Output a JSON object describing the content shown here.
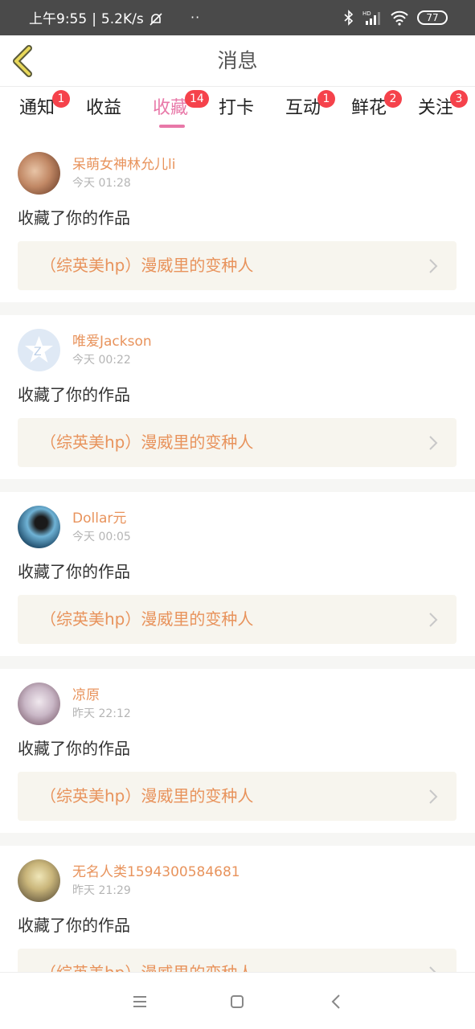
{
  "status_bar": {
    "time": "上午9:55",
    "network_speed": "5.2K/s",
    "dots": "··",
    "battery": "77",
    "icons": [
      "alarm-off-icon",
      "bluetooth-icon",
      "hd-signal-icon",
      "wifi-icon",
      "battery-icon"
    ]
  },
  "header": {
    "title": "消息",
    "back_icon": "chevron-left-icon",
    "accent": "#e8d85a"
  },
  "tabs": [
    {
      "label": "通知",
      "badge": "1"
    },
    {
      "label": "收益",
      "badge": ""
    },
    {
      "label": "收藏",
      "badge": "14",
      "active": true
    },
    {
      "label": "打卡",
      "badge": ""
    },
    {
      "label": "互动",
      "badge": "1"
    },
    {
      "label": "鲜花",
      "badge": "2"
    },
    {
      "label": "关注",
      "badge": "3"
    }
  ],
  "feed": [
    {
      "username": "呆萌女神林允儿li",
      "time": "今天 01:28",
      "action": "收藏了你的作品",
      "work_title": "（综英美hp）漫威里的变种人",
      "avatar_colors": [
        "#e4c1a3",
        "#6b3a24"
      ]
    },
    {
      "username": "唯爱Jackson",
      "time": "今天 00:22",
      "action": "收藏了你的作品",
      "work_title": "（综英美hp）漫威里的变种人",
      "avatar_colors": [
        "#dce8f5",
        "#ffffff"
      ]
    },
    {
      "username": "Dollar元",
      "time": "今天 00:05",
      "action": "收藏了你的作品",
      "work_title": "（综英美hp）漫威里的变种人",
      "avatar_colors": [
        "#3a8fb7",
        "#1b2d3a"
      ]
    },
    {
      "username": "凉原",
      "time": "昨天 22:12",
      "action": "收藏了你的作品",
      "work_title": "（综英美hp）漫威里的变种人",
      "avatar_colors": [
        "#c9bcc8",
        "#7a5a6a"
      ]
    },
    {
      "username": "无名人类1594300584681",
      "time": "昨天 21:29",
      "action": "收藏了你的作品",
      "work_title": "（综英美hp）漫威里的变种人",
      "avatar_colors": [
        "#e3d7a0",
        "#3b3528"
      ]
    }
  ],
  "nav_bar": {
    "icons": [
      "menu-icon",
      "home-square-icon",
      "back-triangle-icon"
    ]
  },
  "colors": {
    "accent_pink": "#e878a8",
    "name_orange": "#e8935c",
    "badge_red": "#f5424b",
    "work_box_bg": "#f7f5ee"
  }
}
